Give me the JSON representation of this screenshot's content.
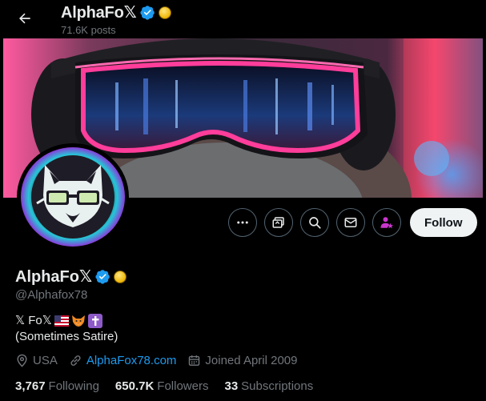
{
  "header": {
    "name": "AlphaFo𝕏",
    "posts": "71.6K posts"
  },
  "profile": {
    "display_name": "AlphaFo𝕏",
    "handle": "@Alphafox78",
    "bio_line1": "𝕏 Fo𝕏",
    "bio_line2": "(Sometimes Satire)",
    "location": "USA",
    "website": "AlphaFox78.com",
    "joined": "Joined April 2009"
  },
  "stats": {
    "following_count": "3,767",
    "following_label": "Following",
    "followers_count": "650.7K",
    "followers_label": "Followers",
    "subscriptions_count": "33",
    "subscriptions_label": "Subscriptions"
  },
  "actions": {
    "follow_label": "Follow"
  },
  "colors": {
    "verified": "#1d9bf0",
    "link": "#1d9bf0",
    "muted": "#71767b",
    "subscribe_accent": "#c936cc"
  },
  "icons": [
    "back-arrow-icon",
    "verified-badge-icon",
    "gold-badge-icon",
    "more-icon",
    "grok-icon",
    "search-icon",
    "message-icon",
    "subscribe-icon",
    "location-icon",
    "link-icon",
    "calendar-icon"
  ]
}
